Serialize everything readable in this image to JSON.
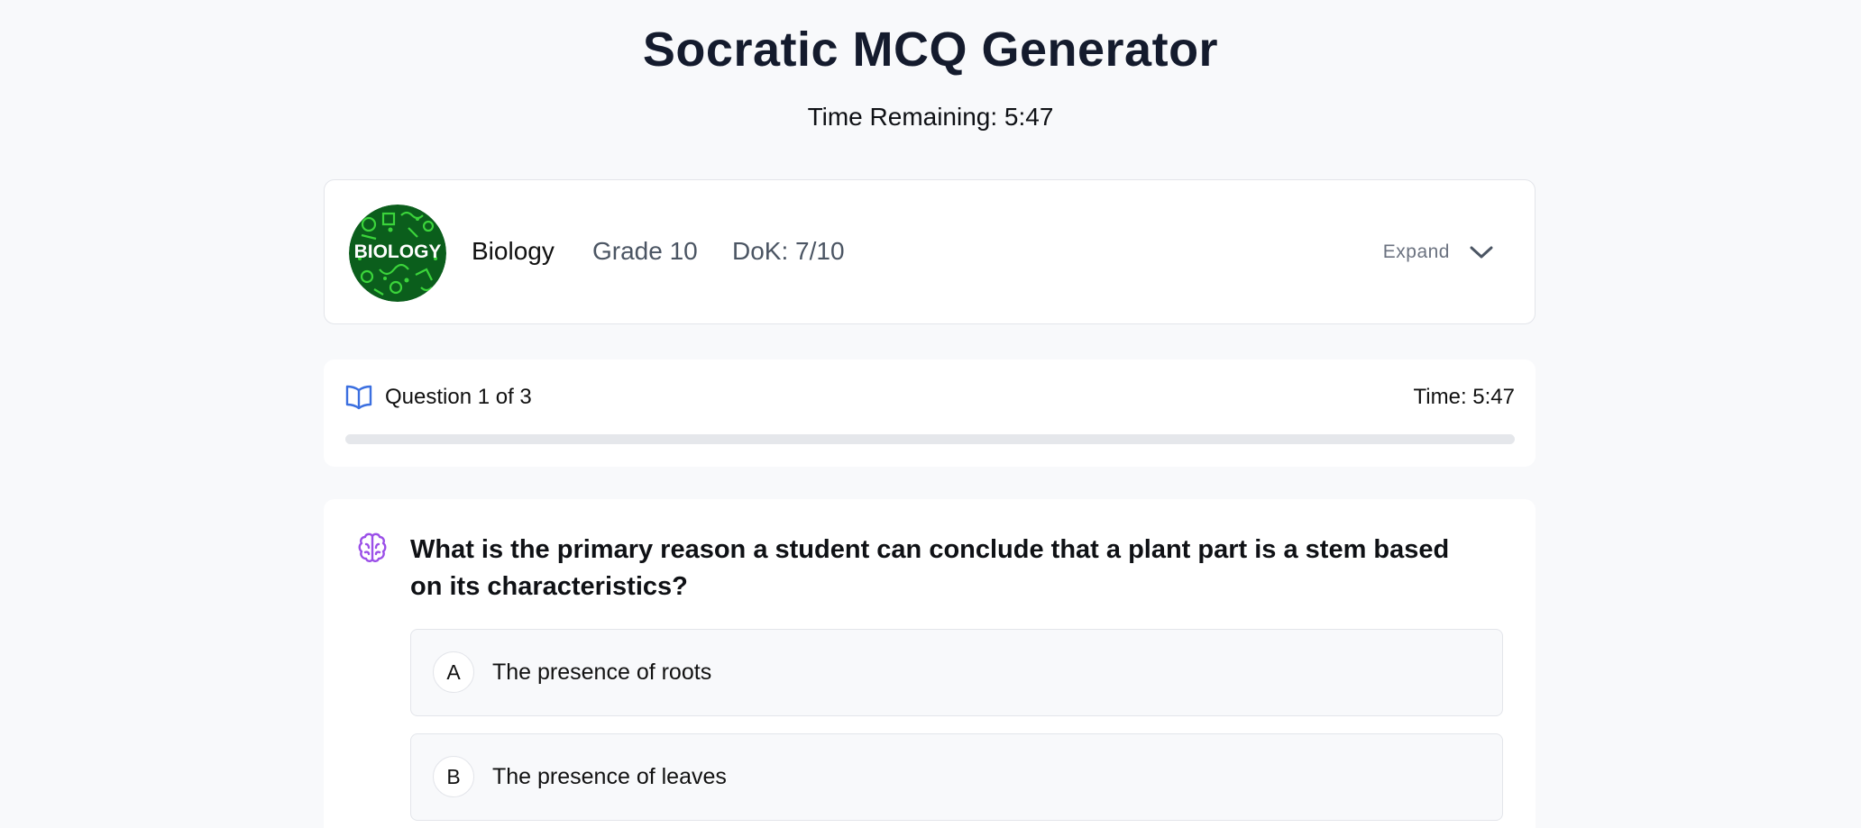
{
  "app": {
    "title": "Socratic MCQ Generator",
    "time_remaining": "Time Remaining: 5:47"
  },
  "subject": {
    "logo_text": "BIOLOGY",
    "logo_colors": {
      "background": "#0b5e1c",
      "accent": "#3bd43b"
    },
    "name": "Biology",
    "grade": "Grade 10",
    "dok": "DoK: 7/10",
    "expand_label": "Expand",
    "expand_icon": "chevron-down-icon"
  },
  "progress": {
    "icon": "book-open-icon",
    "icon_color": "#3b6fe0",
    "counter": "Question 1 of 3",
    "time": "Time: 5:47",
    "fraction": 0
  },
  "question": {
    "icon": "brain-icon",
    "icon_color": "#9b4fe8",
    "text": "What is the primary reason a student can conclude that a plant part is a stem based on its characteristics?",
    "options": [
      {
        "letter": "A",
        "text": "The presence of roots"
      },
      {
        "letter": "B",
        "text": "The presence of leaves"
      }
    ]
  }
}
